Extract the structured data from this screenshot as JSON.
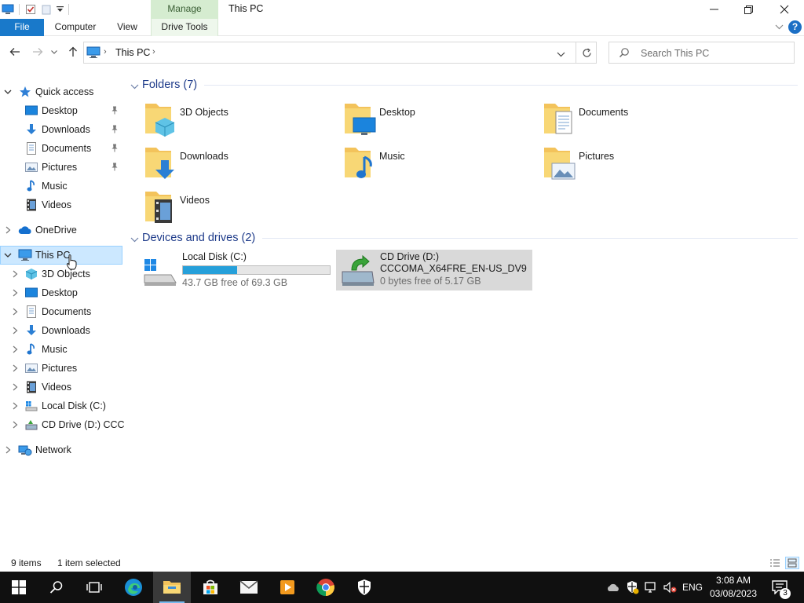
{
  "window": {
    "title": "This PC",
    "contextual_tab_group": "Manage"
  },
  "ribbon": {
    "tabs": [
      {
        "label": "File"
      },
      {
        "label": "Computer"
      },
      {
        "label": "View"
      },
      {
        "label": "Drive Tools"
      }
    ]
  },
  "address": {
    "path": "This PC",
    "search_placeholder": "Search This PC"
  },
  "nav": {
    "quick_access": {
      "label": "Quick access",
      "items": [
        {
          "label": "Desktop",
          "icon": "desktop-icon",
          "pinned": true
        },
        {
          "label": "Downloads",
          "icon": "downloads-icon",
          "pinned": true
        },
        {
          "label": "Documents",
          "icon": "documents-icon",
          "pinned": true
        },
        {
          "label": "Pictures",
          "icon": "pictures-icon",
          "pinned": true
        },
        {
          "label": "Music",
          "icon": "music-icon",
          "pinned": false
        },
        {
          "label": "Videos",
          "icon": "videos-icon",
          "pinned": false
        }
      ]
    },
    "onedrive": "OneDrive",
    "this_pc": {
      "label": "This PC",
      "items": [
        {
          "label": "3D Objects",
          "icon": "3d-objects-icon"
        },
        {
          "label": "Desktop",
          "icon": "desktop-icon"
        },
        {
          "label": "Documents",
          "icon": "documents-icon"
        },
        {
          "label": "Downloads",
          "icon": "downloads-icon"
        },
        {
          "label": "Music",
          "icon": "music-icon"
        },
        {
          "label": "Pictures",
          "icon": "pictures-icon"
        },
        {
          "label": "Videos",
          "icon": "videos-icon"
        },
        {
          "label": "Local Disk (C:)",
          "icon": "local-disk-icon"
        },
        {
          "label": "CD Drive (D:) CCCO",
          "icon": "cd-drive-icon"
        }
      ]
    },
    "network": "Network"
  },
  "content": {
    "folders_header": "Folders (7)",
    "folders": [
      {
        "name": "3D Objects",
        "icon": "3d-objects-folder-icon"
      },
      {
        "name": "Desktop",
        "icon": "desktop-folder-icon"
      },
      {
        "name": "Documents",
        "icon": "documents-folder-icon"
      },
      {
        "name": "Downloads",
        "icon": "downloads-folder-icon"
      },
      {
        "name": "Music",
        "icon": "music-folder-icon"
      },
      {
        "name": "Pictures",
        "icon": "pictures-folder-icon"
      },
      {
        "name": "Videos",
        "icon": "videos-folder-icon"
      }
    ],
    "drives_header": "Devices and drives (2)",
    "drives": [
      {
        "name": "Local Disk (C:)",
        "free_text": "43.7 GB free of 69.3 GB",
        "used_fraction": 0.37,
        "icon": "local-disk-icon"
      },
      {
        "name": "CD Drive (D:)",
        "volume": "CCCOMA_X64FRE_EN-US_DV9",
        "free_text": "0 bytes free of 5.17 GB",
        "icon": "cd-drive-icon"
      }
    ]
  },
  "status": {
    "item_count": "9 items",
    "selection": "1 item selected"
  },
  "taskbar": {
    "language": "ENG",
    "time": "3:08 AM",
    "date": "03/08/2023",
    "notification_count": "3"
  },
  "colors": {
    "accent": "#1979ca",
    "selection": "#cce8ff",
    "drive_bar": "#26a0da",
    "group_header": "#1e3b8a",
    "manage_tab": "#d5ecd0"
  }
}
